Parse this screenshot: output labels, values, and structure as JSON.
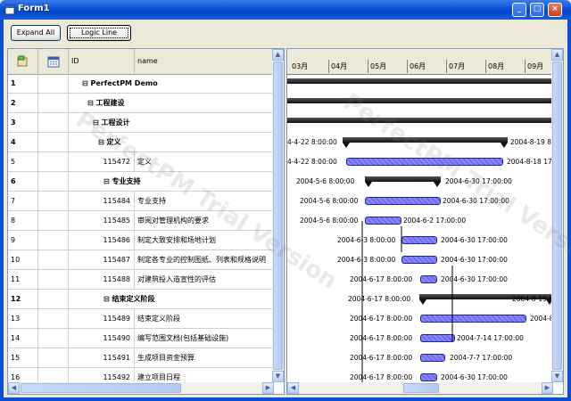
{
  "window": {
    "title": "Form1",
    "minimize": "_",
    "maximize": "□",
    "close": "×"
  },
  "toolbar": {
    "expand_all": "Expand All",
    "logic_line": "Logic Line"
  },
  "grid": {
    "headers": {
      "row_indicator": "",
      "flag_icon": "task-flag-icon",
      "calendar_icon": "calendar-icon",
      "id": "ID",
      "name": "name"
    },
    "rows": [
      {
        "num": "1",
        "id": "",
        "name": "⊟ PerfectPM Demo",
        "bold": true
      },
      {
        "num": "2",
        "id": "",
        "name": "⊟ 工程建设",
        "bold": true
      },
      {
        "num": "3",
        "id": "",
        "name": "⊟ 工程设计",
        "bold": true
      },
      {
        "num": "4",
        "id": "",
        "name": "⊟ 定义",
        "bold": true
      },
      {
        "num": "5",
        "id": "115472",
        "name": "定义",
        "bold": false
      },
      {
        "num": "6",
        "id": "",
        "name": "⊟ 专业支持",
        "bold": true
      },
      {
        "num": "7",
        "id": "115484",
        "name": "专业支持",
        "bold": false
      },
      {
        "num": "8",
        "id": "115485",
        "name": "审阅对管理机构的要求",
        "bold": false
      },
      {
        "num": "9",
        "id": "115486",
        "name": "制定大致安排和场地计划",
        "bold": false
      },
      {
        "num": "10",
        "id": "115487",
        "name": "制定各专业的控制图纸、列表和规格说明",
        "bold": false
      },
      {
        "num": "11",
        "id": "115488",
        "name": "对建筑投入造宣性的评估",
        "bold": false
      },
      {
        "num": "12",
        "id": "",
        "name": "⊟ 结束定义阶段",
        "bold": true
      },
      {
        "num": "13",
        "id": "115489",
        "name": "结束定义阶段",
        "bold": false
      },
      {
        "num": "14",
        "id": "115490",
        "name": "编写范围文档(包括基础设施)",
        "bold": false
      },
      {
        "num": "15",
        "id": "115491",
        "name": "生成项目资金预算",
        "bold": false
      },
      {
        "num": "16",
        "id": "115492",
        "name": "建立项目日程",
        "bold": false
      }
    ]
  },
  "gantt": {
    "months": [
      "03月",
      "04月",
      "05月",
      "06月",
      "07月",
      "08月",
      "09月"
    ],
    "rows": [
      {
        "kind": "summary",
        "left_label": "",
        "right_label": ""
      },
      {
        "kind": "summary",
        "left_label": "",
        "right_label": ""
      },
      {
        "kind": "summary",
        "left_label": "",
        "right_label": ""
      },
      {
        "kind": "summary",
        "left_label": "4-4-22 8:00:00",
        "right_label": "2004-8-19 8:"
      },
      {
        "kind": "task",
        "left_label": "4-4-22 8:00:00",
        "right_label": "2004-8-18 17:"
      },
      {
        "kind": "summary",
        "left_label": "2004-5-6 8:00:00",
        "right_label": "2004-6-30 17:00:00"
      },
      {
        "kind": "task",
        "left_label": "2004-5-6 8:00:00",
        "right_label": "2004-6-30 17:00:00"
      },
      {
        "kind": "task",
        "left_label": "2004-5-6 8:00:00",
        "right_label": "2004-6-2 17:00:00"
      },
      {
        "kind": "task",
        "left_label": "2004-6-3 8:00:00",
        "right_label": "2004-6-30 17:00:00"
      },
      {
        "kind": "task",
        "left_label": "2004-6-3 8:00:00",
        "right_label": "2004-6-30 17:00:00"
      },
      {
        "kind": "task",
        "left_label": "2004-6-17 8:00:00",
        "right_label": "2004-6-30 17:00:00"
      },
      {
        "kind": "summary",
        "left_label": "2004-6-17 8:00:00",
        "right_label": "2004-8-19 8:"
      },
      {
        "kind": "task",
        "left_label": "2004-6-17 8:00:00",
        "right_label": "2004-8-18 17:"
      },
      {
        "kind": "task",
        "left_label": "2004-6-17 8:00:00",
        "right_label": "2004-7-14 17:00:00"
      },
      {
        "kind": "task",
        "left_label": "2004-6-17 8:00:00",
        "right_label": "2004-7-7 17:00:00"
      },
      {
        "kind": "task",
        "left_label": "2004-6-17 8:00:00",
        "right_label": "2004-6-30 17:00:00"
      }
    ]
  },
  "watermark": "PerfectPM Trial Version",
  "colors": {
    "task_bar": "#7A7AF5",
    "summary_bar": "#111111",
    "titlebar": "#0A50D8"
  }
}
